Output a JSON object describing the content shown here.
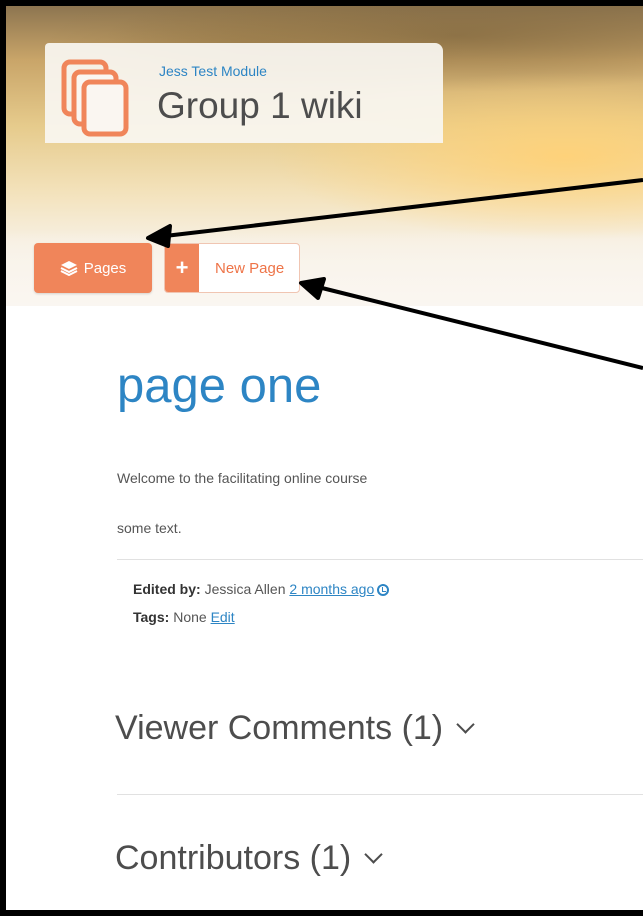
{
  "header": {
    "module_name": "Jess Test Module",
    "wiki_title": "Group 1 wiki",
    "icon": "stacked-pages-icon"
  },
  "toolbar": {
    "pages_label": "Pages",
    "pages_icon": "layers-icon",
    "new_page_label": "New Page",
    "new_page_icon": "plus-icon"
  },
  "page": {
    "title": "page one",
    "paragraphs": [
      "Welcome to the facilitating online course",
      "some text."
    ],
    "edited_by_label": "Edited by:",
    "edited_by_name": "Jessica Allen",
    "edited_time": "2 months ago",
    "tags_label": "Tags:",
    "tags_value": "None",
    "tags_edit": "Edit"
  },
  "sections": {
    "comments": "Viewer Comments (1)",
    "contributors": "Contributors (1)"
  },
  "colors": {
    "accent_orange": "#f0855a",
    "link_blue": "#2d85c4",
    "annotation_arrow": "#000000"
  }
}
